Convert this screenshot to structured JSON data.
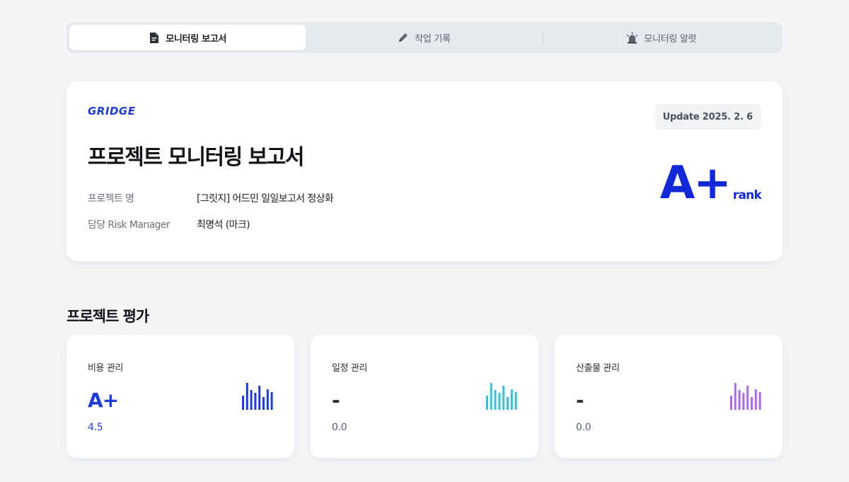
{
  "tabs": [
    {
      "label": "모니터링 보고서",
      "icon": "document-icon",
      "active": true
    },
    {
      "label": "작업 기록",
      "icon": "pencil-icon",
      "active": false
    },
    {
      "label": "모니터링 알럿",
      "icon": "siren-icon",
      "active": false
    }
  ],
  "report": {
    "logo_text": "GRIDGE",
    "update": "Update 2025. 2. 6",
    "title": "프로젝트 모니터링 보고서",
    "project_label": "프로젝트 명",
    "project_value": "[그릿지] 어드민 일일보고서 정상화",
    "manager_label": "담당 Risk Manager",
    "manager_value": "최명석 (마크)",
    "rank_grade": "A+",
    "rank_label": "rank"
  },
  "evaluation": {
    "title": "프로젝트 평가",
    "cards": [
      {
        "label": "비용 관리",
        "grade": "A+",
        "score": "4.5",
        "accent": "#1f3bd6",
        "icon": "bar-chart-icon"
      },
      {
        "label": "일정 관리",
        "grade": "-",
        "score": "0.0",
        "accent": "#35c1d8",
        "icon": "bar-chart-icon"
      },
      {
        "label": "산출물 관리",
        "grade": "-",
        "score": "0.0",
        "accent": "#a76ae8",
        "icon": "bar-chart-icon"
      }
    ]
  },
  "colors": {
    "brand": "#1328d8",
    "background": "#f3f5f7",
    "text_dark": "#111316",
    "text_muted": "#6b717c"
  }
}
